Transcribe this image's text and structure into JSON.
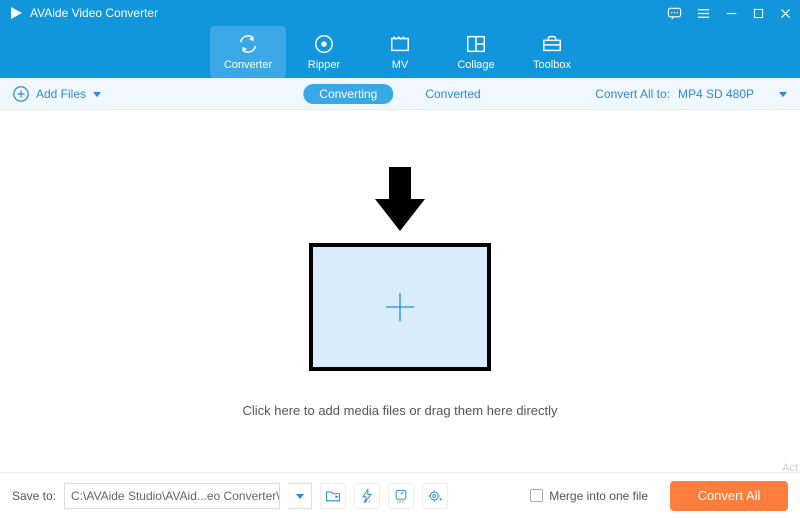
{
  "app": {
    "title": "AVAide Video Converter"
  },
  "tabs": {
    "converter": "Converter",
    "ripper": "Ripper",
    "mv": "MV",
    "collage": "Collage",
    "toolbox": "Toolbox"
  },
  "subbar": {
    "add_files": "Add Files",
    "converting": "Converting",
    "converted": "Converted",
    "convert_all_to": "Convert All to:",
    "format": "MP4 SD 480P"
  },
  "stage": {
    "hint": "Click here to add media files or drag them here directly"
  },
  "bottom": {
    "save_to_label": "Save to:",
    "save_to_path": "C:\\AVAide Studio\\AVAid...eo Converter\\Converted",
    "merge_label": "Merge into one file",
    "convert_all": "Convert All"
  },
  "watermark": "Act"
}
